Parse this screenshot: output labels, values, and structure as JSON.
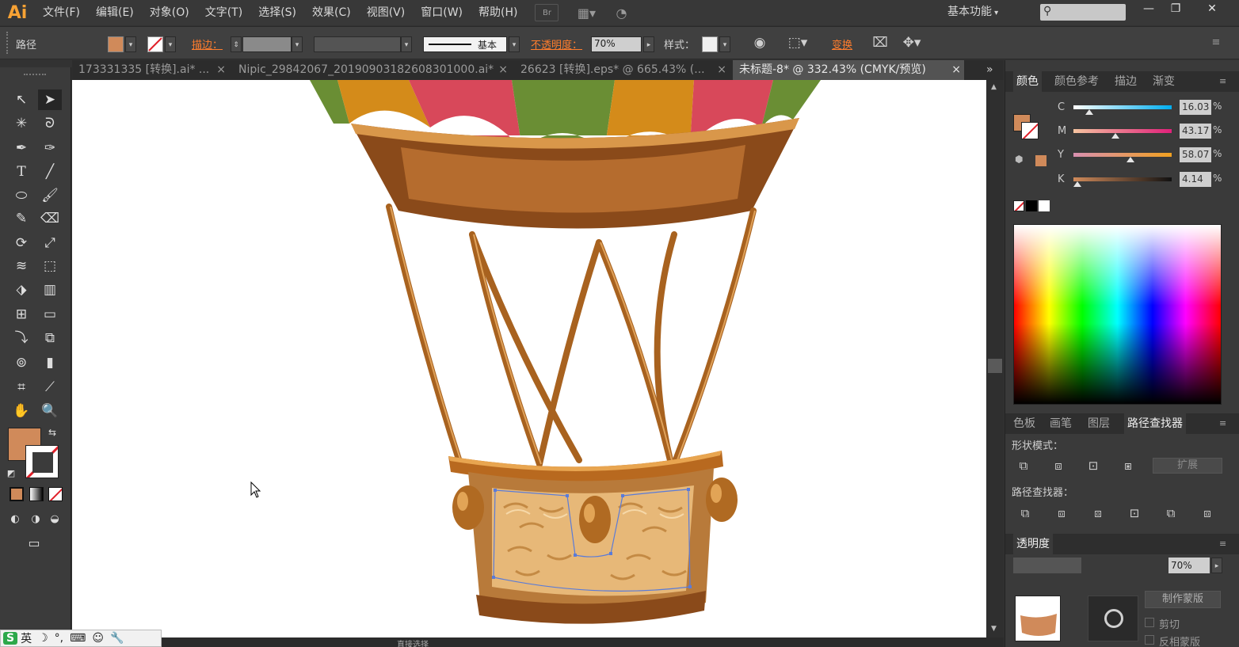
{
  "app": {
    "logo": "Ai",
    "workspace": "基本功能"
  },
  "menu": [
    "文件(F)",
    "编辑(E)",
    "对象(O)",
    "文字(T)",
    "选择(S)",
    "效果(C)",
    "视图(V)",
    "窗口(W)",
    "帮助(H)"
  ],
  "menubar_icons": [
    "Br"
  ],
  "window_controls": [
    "—",
    "❐",
    "✕"
  ],
  "control": {
    "selection_label": "路径",
    "stroke_label": "描边：",
    "brush_label": "基本",
    "opacity_label": "不透明度：",
    "opacity_value": "70%",
    "style_label": "样式：",
    "transform_label": "变换",
    "fill_color": "#d08a5a"
  },
  "tabs": [
    {
      "label": "173331335 [转换].ai* ..."
    },
    {
      "label": "Nipic_29842067_20190903182608301000.ai*"
    },
    {
      "label": "26623 [转换].eps* @ 665.43% (..."
    },
    {
      "label": "未标题-8* @ 332.43% (CMYK/预览)"
    }
  ],
  "tab_close": "×",
  "tab_overflow": "»",
  "color_panel": {
    "tabs": [
      "颜色",
      "颜色参考",
      "描边",
      "渐变"
    ],
    "channels": [
      {
        "name": "C",
        "value": "16.03",
        "pos": 0.16
      },
      {
        "name": "M",
        "value": "43.17",
        "pos": 0.43
      },
      {
        "name": "Y",
        "value": "58.07",
        "pos": 0.58
      },
      {
        "name": "K",
        "value": "4.14",
        "pos": 0.04
      }
    ],
    "percent": "%",
    "fill_color": "#d08a5a"
  },
  "pathfinder_panel": {
    "tabs": [
      "色板",
      "画笔",
      "图层",
      "路径查找器"
    ],
    "shape_modes_label": "形状模式：",
    "expand_label": "扩展",
    "pathfinders_label": "路径查找器："
  },
  "transparency_panel": {
    "title": "透明度",
    "opacity": "70%",
    "make_mask_label": "制作蒙版",
    "clip_label": "剪切",
    "invert_mask_label": "反相蒙版"
  },
  "status": {
    "tool_name": "直接选择"
  },
  "ime": {
    "logo": "S",
    "lang": "英"
  }
}
